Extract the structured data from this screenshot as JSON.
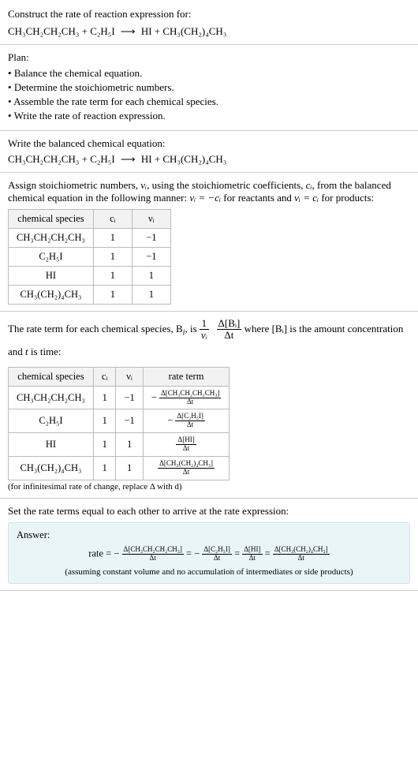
{
  "s1": {
    "title": "Construct the rate of reaction expression for:",
    "eq_lhs1": "CH₃CH₂CH₂CH₃",
    "eq_lhs2": "C₂H₅I",
    "eq_rhs1": "HI",
    "eq_rhs2": "CH₃(CH₂)₄CH₃",
    "arrow": "⟶"
  },
  "plan": {
    "title": "Plan:",
    "items": [
      "Balance the chemical equation.",
      "Determine the stoichiometric numbers.",
      "Assemble the rate term for each chemical species.",
      "Write the rate of reaction expression."
    ]
  },
  "s2": {
    "title": "Write the balanced chemical equation:",
    "eq_lhs1": "CH₃CH₂CH₂CH₃",
    "eq_lhs2": "C₂H₅I",
    "eq_rhs1": "HI",
    "eq_rhs2": "CH₃(CH₂)₄CH₃",
    "arrow": "⟶"
  },
  "s3": {
    "intro1": "Assign stoichiometric numbers, ",
    "nui": "νᵢ",
    "intro2": ", using the stoichiometric coefficients, ",
    "ci": "cᵢ",
    "intro3": ", from the balanced chemical equation in the following manner: ",
    "rel1": "νᵢ = −cᵢ",
    "intro4": " for reactants and ",
    "rel2": "νᵢ = cᵢ",
    "intro5": " for products:",
    "header": [
      "chemical species",
      "cᵢ",
      "νᵢ"
    ],
    "rows": [
      {
        "sp": "CH₃CH₂CH₂CH₃",
        "c": "1",
        "v": "−1"
      },
      {
        "sp": "C₂H₅I",
        "c": "1",
        "v": "−1"
      },
      {
        "sp": "HI",
        "c": "1",
        "v": "1"
      },
      {
        "sp": "CH₃(CH₂)₄CH₃",
        "c": "1",
        "v": "1"
      }
    ]
  },
  "s4": {
    "intro1": "The rate term for each chemical species, B",
    "isub": "i",
    "intro2": ", is ",
    "numer1": "1",
    "denom1": "νᵢ",
    "numer2": "Δ[Bᵢ]",
    "denom2": "Δt",
    "intro3": " where [Bᵢ] is the amount concentration and ",
    "tvar": "t",
    "intro4": " is time:",
    "header": [
      "chemical species",
      "cᵢ",
      "νᵢ",
      "rate term"
    ],
    "rows": [
      {
        "sp": "CH₃CH₂CH₂CH₃",
        "c": "1",
        "v": "−1",
        "rt_num": "Δ[CH₃CH₂CH₂CH₃]",
        "rt_den": "Δt",
        "neg": "−"
      },
      {
        "sp": "C₂H₅I",
        "c": "1",
        "v": "−1",
        "rt_num": "Δ[C₂H₅I]",
        "rt_den": "Δt",
        "neg": "−"
      },
      {
        "sp": "HI",
        "c": "1",
        "v": "1",
        "rt_num": "Δ[HI]",
        "rt_den": "Δt",
        "neg": ""
      },
      {
        "sp": "CH₃(CH₂)₄CH₃",
        "c": "1",
        "v": "1",
        "rt_num": "Δ[CH₃(CH₂)₄CH₃]",
        "rt_den": "Δt",
        "neg": ""
      }
    ],
    "note": "(for infinitesimal rate of change, replace Δ with d)"
  },
  "s5": {
    "title": "Set the rate terms equal to each other to arrive at the rate expression:",
    "answer": "Answer:",
    "ratelabel": "rate",
    "eq": "=",
    "neg": "−",
    "terms": [
      {
        "num": "Δ[CH₃CH₂CH₂CH₃]",
        "den": "Δt",
        "neg": "−"
      },
      {
        "num": "Δ[C₂H₅I]",
        "den": "Δt",
        "neg": "−"
      },
      {
        "num": "Δ[HI]",
        "den": "Δt",
        "neg": ""
      },
      {
        "num": "Δ[CH₃(CH₂)₄CH₃]",
        "den": "Δt",
        "neg": ""
      }
    ],
    "note": "(assuming constant volume and no accumulation of intermediates or side products)"
  }
}
